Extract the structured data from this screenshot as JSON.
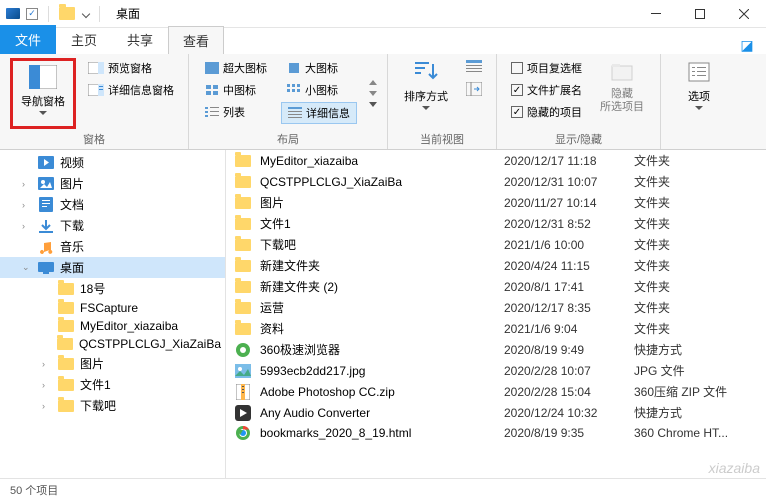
{
  "titlebar": {
    "title": "桌面"
  },
  "tabs": {
    "file": "文件",
    "home": "主页",
    "share": "共享",
    "view": "查看"
  },
  "ribbon": {
    "panes_label": "窗格",
    "nav_pane": "导航窗格",
    "preview_pane": "预览窗格",
    "details_pane": "详细信息窗格",
    "layout_label": "布局",
    "xl_icons": "超大图标",
    "l_icons": "大图标",
    "m_icons": "中图标",
    "s_icons": "小图标",
    "list": "列表",
    "details": "详细信息",
    "current_label": "当前视图",
    "sort_by": "排序方式",
    "show_hide_label": "显示/隐藏",
    "item_cb": "项目复选框",
    "ext": "文件扩展名",
    "hidden": "隐藏的项目",
    "hide": "隐藏\n所选项目",
    "options": "选项"
  },
  "tree": [
    {
      "icon": "video",
      "label": "视频",
      "ex": ""
    },
    {
      "icon": "pic",
      "label": "图片",
      "ex": ">"
    },
    {
      "icon": "doc",
      "label": "文档",
      "ex": ">"
    },
    {
      "icon": "down",
      "label": "下载",
      "ex": ">"
    },
    {
      "icon": "music",
      "label": "音乐",
      "ex": ""
    },
    {
      "icon": "desk",
      "label": "桌面",
      "ex": "v",
      "sel": true
    },
    {
      "icon": "fold",
      "label": "18号",
      "ex": "",
      "sub": true
    },
    {
      "icon": "fold",
      "label": "FSCapture",
      "ex": "",
      "sub": true
    },
    {
      "icon": "fold",
      "label": "MyEditor_xiazaiba",
      "ex": "",
      "sub": true
    },
    {
      "icon": "fold",
      "label": "QCSTPPLCLGJ_XiaZaiBa",
      "ex": "",
      "sub": true
    },
    {
      "icon": "fold",
      "label": "图片",
      "ex": ">",
      "sub": true
    },
    {
      "icon": "fold",
      "label": "文件1",
      "ex": ">",
      "sub": true
    },
    {
      "icon": "fold",
      "label": "下载吧",
      "ex": ">",
      "sub": true
    }
  ],
  "files": [
    {
      "icon": "fold",
      "name": "MyEditor_xiazaiba",
      "date": "2020/12/17 11:18",
      "type": "文件夹"
    },
    {
      "icon": "fold",
      "name": "QCSTPPLCLGJ_XiaZaiBa",
      "date": "2020/12/31 10:07",
      "type": "文件夹"
    },
    {
      "icon": "fold",
      "name": "图片",
      "date": "2020/11/27 10:14",
      "type": "文件夹"
    },
    {
      "icon": "fold",
      "name": "文件1",
      "date": "2020/12/31 8:52",
      "type": "文件夹"
    },
    {
      "icon": "fold",
      "name": "下载吧",
      "date": "2021/1/6 10:00",
      "type": "文件夹"
    },
    {
      "icon": "fold",
      "name": "新建文件夹",
      "date": "2020/4/24 11:15",
      "type": "文件夹"
    },
    {
      "icon": "fold",
      "name": "新建文件夹 (2)",
      "date": "2020/8/1 17:41",
      "type": "文件夹"
    },
    {
      "icon": "fold",
      "name": "运营",
      "date": "2020/12/17 8:35",
      "type": "文件夹"
    },
    {
      "icon": "fold",
      "name": "资料",
      "date": "2021/1/6 9:04",
      "type": "文件夹"
    },
    {
      "icon": "app",
      "name": "360极速浏览器",
      "date": "2020/8/19 9:49",
      "type": "快捷方式"
    },
    {
      "icon": "img",
      "name": "5993ecb2dd217.jpg",
      "date": "2020/2/28 10:07",
      "type": "JPG 文件"
    },
    {
      "icon": "zip",
      "name": "Adobe Photoshop CC.zip",
      "date": "2020/2/28 15:04",
      "type": "360压缩 ZIP 文件"
    },
    {
      "icon": "app2",
      "name": "Any Audio Converter",
      "date": "2020/12/24 10:32",
      "type": "快捷方式"
    },
    {
      "icon": "chr",
      "name": "bookmarks_2020_8_19.html",
      "date": "2020/8/19 9:35",
      "type": "360 Chrome HT..."
    }
  ],
  "status": {
    "count": "50 个项目"
  },
  "watermark": "xiazaiba"
}
